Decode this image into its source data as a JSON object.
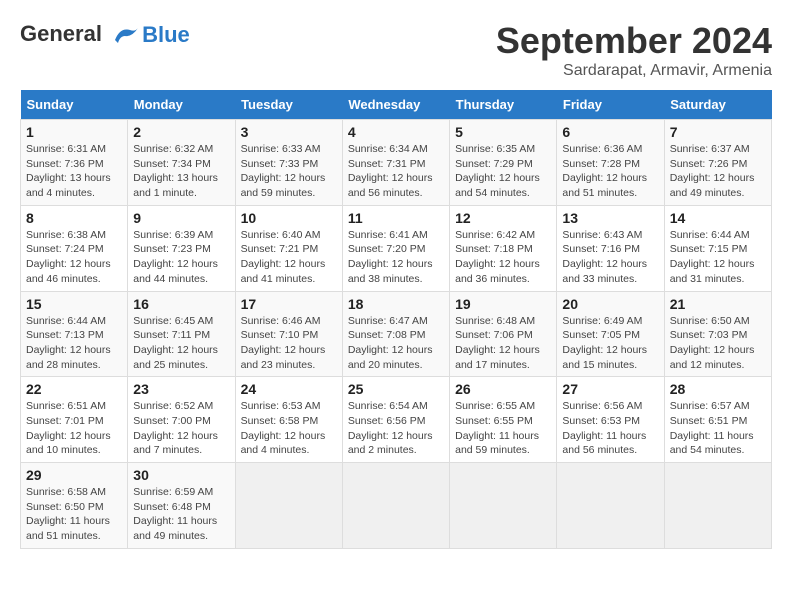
{
  "header": {
    "logo_line1": "General",
    "logo_line2": "Blue",
    "title": "September 2024",
    "location": "Sardarapat, Armavir, Armenia"
  },
  "days_of_week": [
    "Sunday",
    "Monday",
    "Tuesday",
    "Wednesday",
    "Thursday",
    "Friday",
    "Saturday"
  ],
  "weeks": [
    [
      {
        "day": "1",
        "rise": "6:31 AM",
        "set": "7:36 PM",
        "daylight": "13 hours and 4 minutes."
      },
      {
        "day": "2",
        "rise": "6:32 AM",
        "set": "7:34 PM",
        "daylight": "13 hours and 1 minute."
      },
      {
        "day": "3",
        "rise": "6:33 AM",
        "set": "7:33 PM",
        "daylight": "12 hours and 59 minutes."
      },
      {
        "day": "4",
        "rise": "6:34 AM",
        "set": "7:31 PM",
        "daylight": "12 hours and 56 minutes."
      },
      {
        "day": "5",
        "rise": "6:35 AM",
        "set": "7:29 PM",
        "daylight": "12 hours and 54 minutes."
      },
      {
        "day": "6",
        "rise": "6:36 AM",
        "set": "7:28 PM",
        "daylight": "12 hours and 51 minutes."
      },
      {
        "day": "7",
        "rise": "6:37 AM",
        "set": "7:26 PM",
        "daylight": "12 hours and 49 minutes."
      }
    ],
    [
      {
        "day": "8",
        "rise": "6:38 AM",
        "set": "7:24 PM",
        "daylight": "12 hours and 46 minutes."
      },
      {
        "day": "9",
        "rise": "6:39 AM",
        "set": "7:23 PM",
        "daylight": "12 hours and 44 minutes."
      },
      {
        "day": "10",
        "rise": "6:40 AM",
        "set": "7:21 PM",
        "daylight": "12 hours and 41 minutes."
      },
      {
        "day": "11",
        "rise": "6:41 AM",
        "set": "7:20 PM",
        "daylight": "12 hours and 38 minutes."
      },
      {
        "day": "12",
        "rise": "6:42 AM",
        "set": "7:18 PM",
        "daylight": "12 hours and 36 minutes."
      },
      {
        "day": "13",
        "rise": "6:43 AM",
        "set": "7:16 PM",
        "daylight": "12 hours and 33 minutes."
      },
      {
        "day": "14",
        "rise": "6:44 AM",
        "set": "7:15 PM",
        "daylight": "12 hours and 31 minutes."
      }
    ],
    [
      {
        "day": "15",
        "rise": "6:44 AM",
        "set": "7:13 PM",
        "daylight": "12 hours and 28 minutes."
      },
      {
        "day": "16",
        "rise": "6:45 AM",
        "set": "7:11 PM",
        "daylight": "12 hours and 25 minutes."
      },
      {
        "day": "17",
        "rise": "6:46 AM",
        "set": "7:10 PM",
        "daylight": "12 hours and 23 minutes."
      },
      {
        "day": "18",
        "rise": "6:47 AM",
        "set": "7:08 PM",
        "daylight": "12 hours and 20 minutes."
      },
      {
        "day": "19",
        "rise": "6:48 AM",
        "set": "7:06 PM",
        "daylight": "12 hours and 17 minutes."
      },
      {
        "day": "20",
        "rise": "6:49 AM",
        "set": "7:05 PM",
        "daylight": "12 hours and 15 minutes."
      },
      {
        "day": "21",
        "rise": "6:50 AM",
        "set": "7:03 PM",
        "daylight": "12 hours and 12 minutes."
      }
    ],
    [
      {
        "day": "22",
        "rise": "6:51 AM",
        "set": "7:01 PM",
        "daylight": "12 hours and 10 minutes."
      },
      {
        "day": "23",
        "rise": "6:52 AM",
        "set": "7:00 PM",
        "daylight": "12 hours and 7 minutes."
      },
      {
        "day": "24",
        "rise": "6:53 AM",
        "set": "6:58 PM",
        "daylight": "12 hours and 4 minutes."
      },
      {
        "day": "25",
        "rise": "6:54 AM",
        "set": "6:56 PM",
        "daylight": "12 hours and 2 minutes."
      },
      {
        "day": "26",
        "rise": "6:55 AM",
        "set": "6:55 PM",
        "daylight": "11 hours and 59 minutes."
      },
      {
        "day": "27",
        "rise": "6:56 AM",
        "set": "6:53 PM",
        "daylight": "11 hours and 56 minutes."
      },
      {
        "day": "28",
        "rise": "6:57 AM",
        "set": "6:51 PM",
        "daylight": "11 hours and 54 minutes."
      }
    ],
    [
      {
        "day": "29",
        "rise": "6:58 AM",
        "set": "6:50 PM",
        "daylight": "11 hours and 51 minutes."
      },
      {
        "day": "30",
        "rise": "6:59 AM",
        "set": "6:48 PM",
        "daylight": "11 hours and 49 minutes."
      },
      null,
      null,
      null,
      null,
      null
    ]
  ]
}
